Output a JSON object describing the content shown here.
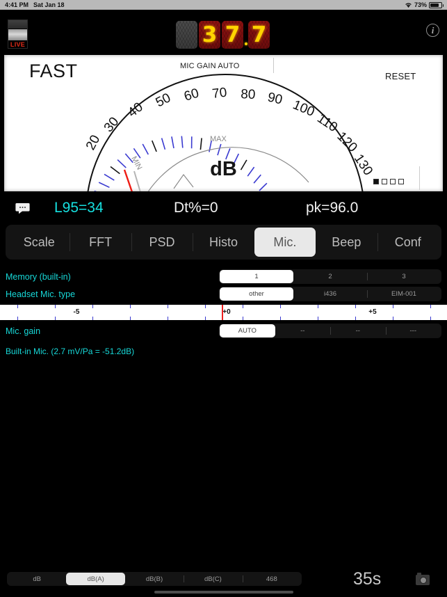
{
  "status_bar": {
    "time": "4:41 PM",
    "date": "Sat Jan 18",
    "battery_percent": "73%",
    "wifi_icon": "wifi-icon",
    "battery_icon": "battery-icon"
  },
  "header": {
    "live_label": "LIVE",
    "led_digits": [
      "",
      "3",
      "7",
      "7"
    ],
    "led_value": "37.7",
    "led_color": "#ffd400",
    "led_bg": "#7d1010",
    "info_label": "i"
  },
  "meter": {
    "response_mode": "FAST",
    "mic_gain_status": "MIC GAIN AUTO",
    "reset_label": "RESET",
    "unit_label": "dB",
    "min_label": "MIN",
    "max_label": "MAX",
    "scale_ticks": [
      "20",
      "30",
      "40",
      "50",
      "60",
      "70",
      "80",
      "90",
      "100",
      "110",
      "120",
      "130"
    ],
    "needle_value": 37.7,
    "needle_color": "#ee1c14",
    "page_dots": 4,
    "page_dot_active": 0
  },
  "readout": {
    "bubble_icon": "speech-bubble-icon",
    "l95": "L95=34",
    "dt": "Dt%=0",
    "pk": "pk=96.0"
  },
  "tabs": [
    {
      "label": "Scale",
      "active": false
    },
    {
      "label": "FFT",
      "active": false
    },
    {
      "label": "PSD",
      "active": false
    },
    {
      "label": "Histo",
      "active": false
    },
    {
      "label": "Mic.",
      "active": true
    },
    {
      "label": "Beep",
      "active": false
    },
    {
      "label": "Conf",
      "active": false
    }
  ],
  "settings": {
    "memory": {
      "label": "Memory (built-in)",
      "options": [
        "1",
        "2",
        "3"
      ],
      "selected": 0
    },
    "headset": {
      "label": "Headset Mic. type",
      "options": [
        "other",
        "i436",
        "EIM-001"
      ],
      "selected": 0
    },
    "mic_gain": {
      "label": "Mic. gain",
      "options": [
        "AUTO",
        "--",
        "--",
        "---"
      ],
      "selected": 0
    },
    "builtin_note": "Built-in Mic. (2.7 mV/Pa = -51.2dB)"
  },
  "ruler": {
    "labels": [
      "-5",
      "+0",
      "+5"
    ],
    "cursor_value": "+0",
    "cursor_color": "#ee2020"
  },
  "bottom_bar": {
    "weighting": {
      "options": [
        "dB",
        "dB(A)",
        "dB(B)",
        "dB(C)",
        "468"
      ],
      "selected": 1
    },
    "timer": "35s",
    "camera_icon": "camera-icon"
  }
}
